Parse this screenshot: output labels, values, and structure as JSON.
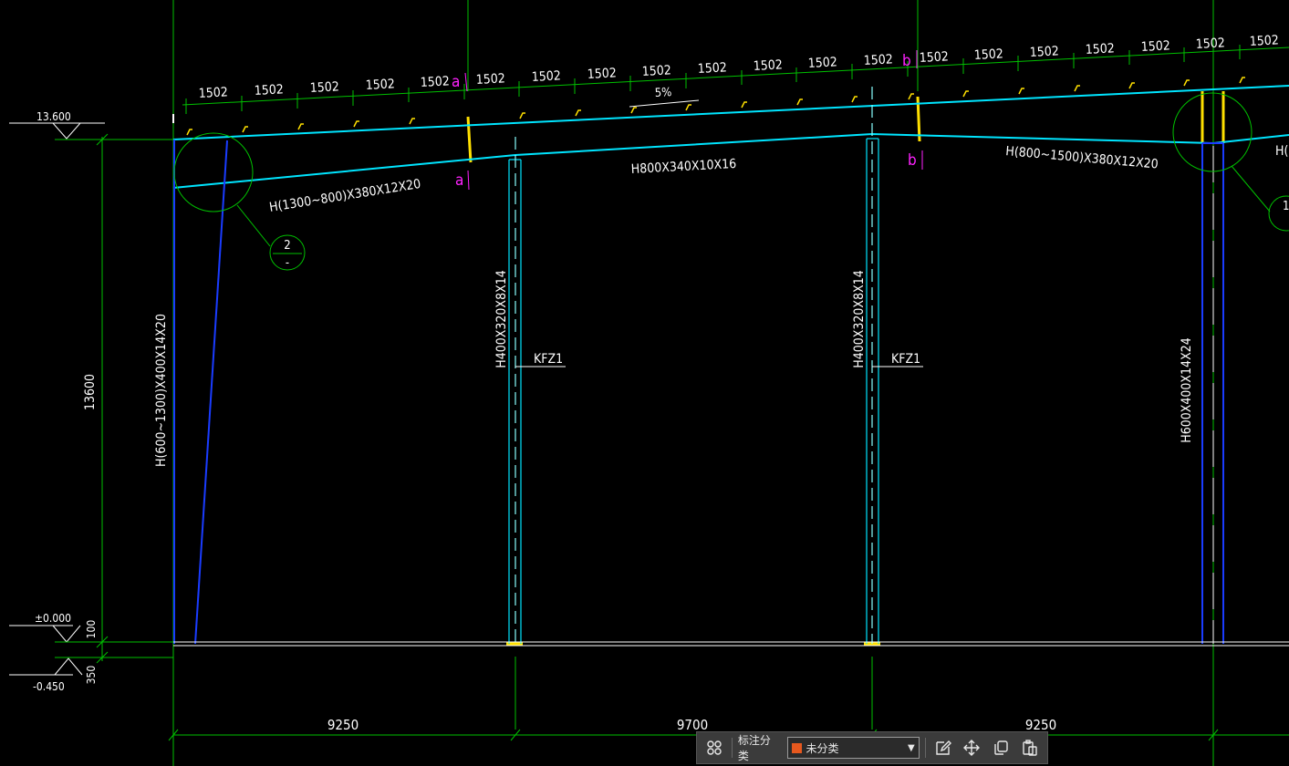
{
  "drawing": {
    "elevation_top": "13.600",
    "elevation_zero": "±0.000",
    "elevation_bottom": "-0.450",
    "vertical_dim_total": "13600",
    "vertical_dim_small_1": "100",
    "vertical_dim_small_2": "350",
    "purlin_spacing": "1502",
    "slope_label": "5%",
    "bay_dims": [
      "9250",
      "9700",
      "9250"
    ],
    "beam_left": "H(1300~800)X380X12X20",
    "beam_mid": "H800X340X10X16",
    "beam_right": "H(800~1500)X380X12X20",
    "beam_right_partial": "H(",
    "col_left": "H(600~1300)X400X14X20",
    "col_kfz_1": "H400X320X8X14",
    "col_kfz_2": "H400X320X8X14",
    "col_right": "H600X400X14X24",
    "col_kfz_label": "KFZ1",
    "detail_2_num": "2",
    "detail_1_num": "1",
    "detail_sub": "-",
    "section_a": "a",
    "section_b": "b"
  },
  "toolbar": {
    "grid_icon": "grid-icon",
    "label": "标注分类",
    "select_value": "未分类",
    "select_color": "#e6581e",
    "edit_icon": "edit-icon",
    "move_icon": "move-icon",
    "copy_icon": "copy-icon",
    "paste_icon": "paste-icon"
  }
}
